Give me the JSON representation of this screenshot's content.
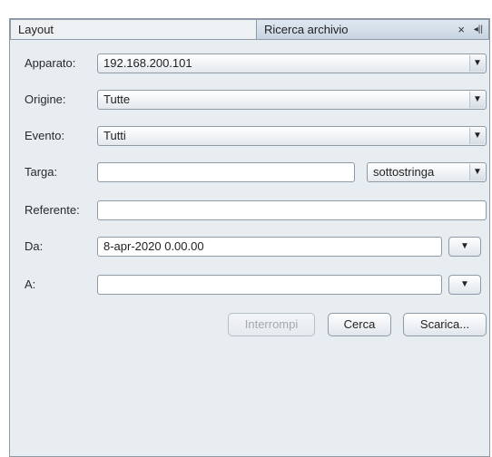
{
  "tabs": [
    {
      "label": "Layout"
    },
    {
      "label": "Ricerca archivio",
      "close": "×",
      "pin": "◂||"
    }
  ],
  "form": {
    "apparato": {
      "label": "Apparato:",
      "value": "192.168.200.101"
    },
    "origine": {
      "label": "Origine:",
      "value": "Tutte"
    },
    "evento": {
      "label": "Evento:",
      "value": "Tutti"
    },
    "targa": {
      "label": "Targa:",
      "value": "",
      "mode": "sottostringa"
    },
    "referente": {
      "label": "Referente:",
      "value": ""
    },
    "da": {
      "label": "Da:",
      "value": "8-apr-2020 0.00.00"
    },
    "a": {
      "label": "A:",
      "value": ""
    }
  },
  "buttons": {
    "interrompi": "Interrompi",
    "cerca": "Cerca",
    "scarica": "Scarica..."
  },
  "icons": {
    "dropdown": "▼"
  }
}
